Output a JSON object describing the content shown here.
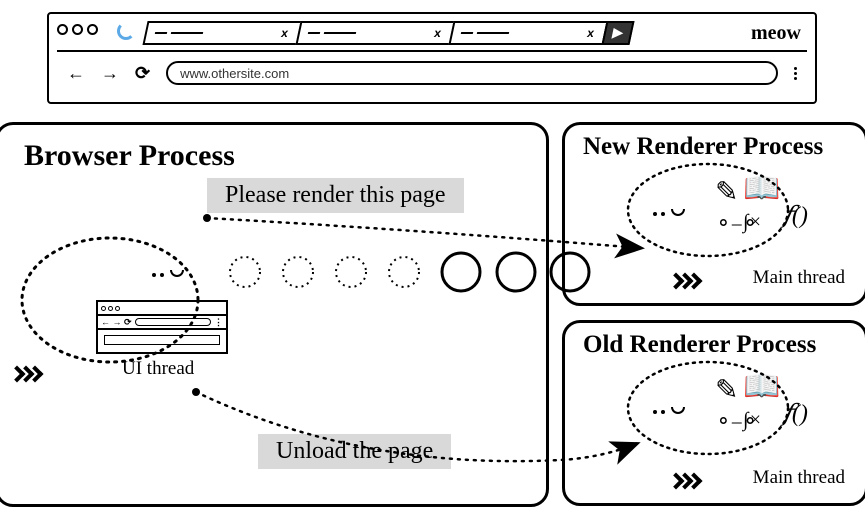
{
  "chrome": {
    "brand": "meow",
    "url": "www.othersite.com",
    "tabs": [
      {
        "mid": ".. - .",
        "close": "x"
      },
      {
        "mid": ".. - .",
        "close": "x"
      },
      {
        "mid": ".. - .",
        "close": "x"
      }
    ],
    "nav": {
      "back": "←",
      "forward": "→",
      "reload": "⟳"
    }
  },
  "browser_process": {
    "title": "Browser Process",
    "ui_thread": "UI thread"
  },
  "labels": {
    "render": "Please render this page",
    "unload": "Unload the page"
  },
  "new_renderer": {
    "title": "New Renderer Process",
    "thread": "Main thread"
  },
  "old_renderer": {
    "title": "Old Renderer Process",
    "thread": "Main thread"
  }
}
